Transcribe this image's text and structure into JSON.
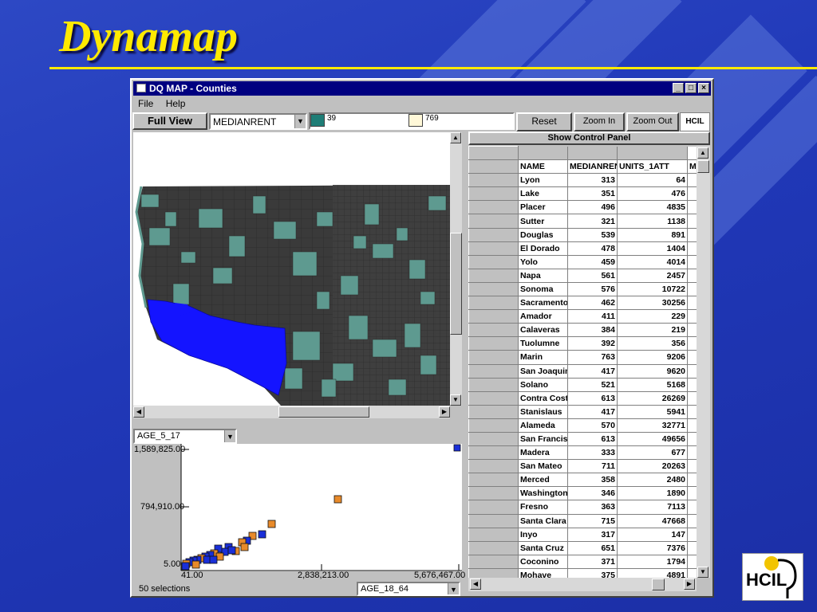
{
  "slide": {
    "title": "Dynamap"
  },
  "window": {
    "title": "DQ MAP - Counties",
    "controls": {
      "minimize": "_",
      "maximize": "□",
      "close": "×"
    }
  },
  "menu": [
    "File",
    "Help"
  ],
  "toolbar": {
    "full_view": "Full View",
    "attribute": "MEDIANRENT",
    "range_min": "39",
    "range_max": "769",
    "reset": "Reset",
    "zoom_in": "Zoom In",
    "zoom_out": "Zoom Out",
    "show_control_panel": "Show Control Panel"
  },
  "colors": {
    "dark_county": "#3a3a3a",
    "teal_county": "#5e9a90",
    "selected_region": "#1414ff",
    "range_min_swatch": "#1e7d76",
    "range_max_swatch": "#fff8d8",
    "orange_point": "#e88a2a",
    "blue_point": "#1a2fd8"
  },
  "scatter": {
    "y_attribute": "AGE_5_17",
    "x_attribute": "AGE_18_64",
    "y_ticks": [
      "1,589,825.00",
      "794,910.00",
      "5.00"
    ],
    "x_ticks": [
      "41.00",
      "2,838,213.00",
      "5,676,467.00"
    ],
    "status": "50 selections"
  },
  "table": {
    "columns": [
      "NAME",
      "MEDIANRENT",
      "UNITS_1ATT",
      "M"
    ],
    "rows": [
      [
        "Lyon",
        "313",
        "64"
      ],
      [
        "Lake",
        "351",
        "476"
      ],
      [
        "Placer",
        "496",
        "4835"
      ],
      [
        "Sutter",
        "321",
        "1138"
      ],
      [
        "Douglas",
        "539",
        "891"
      ],
      [
        "El Dorado",
        "478",
        "1404"
      ],
      [
        "Yolo",
        "459",
        "4014"
      ],
      [
        "Napa",
        "561",
        "2457"
      ],
      [
        "Sonoma",
        "576",
        "10722"
      ],
      [
        "Sacramento",
        "462",
        "30256"
      ],
      [
        "Amador",
        "411",
        "229"
      ],
      [
        "Calaveras",
        "384",
        "219"
      ],
      [
        "Tuolumne",
        "392",
        "356"
      ],
      [
        "Marin",
        "763",
        "9206"
      ],
      [
        "San Joaquin",
        "417",
        "9620"
      ],
      [
        "Solano",
        "521",
        "5168"
      ],
      [
        "Contra Costa",
        "613",
        "26269"
      ],
      [
        "Stanislaus",
        "417",
        "5941"
      ],
      [
        "Alameda",
        "570",
        "32771"
      ],
      [
        "San Francisco",
        "613",
        "49656"
      ],
      [
        "Madera",
        "333",
        "677"
      ],
      [
        "San Mateo",
        "711",
        "20263"
      ],
      [
        "Merced",
        "358",
        "2480"
      ],
      [
        "Washington",
        "346",
        "1890"
      ],
      [
        "Fresno",
        "363",
        "7113"
      ],
      [
        "Santa Clara",
        "715",
        "47668"
      ],
      [
        "Inyo",
        "317",
        "147"
      ],
      [
        "Santa Cruz",
        "651",
        "7376"
      ],
      [
        "Coconino",
        "371",
        "1794"
      ],
      [
        "Mohave",
        "375",
        "4891"
      ]
    ]
  },
  "logo": {
    "text": "HCIL"
  }
}
